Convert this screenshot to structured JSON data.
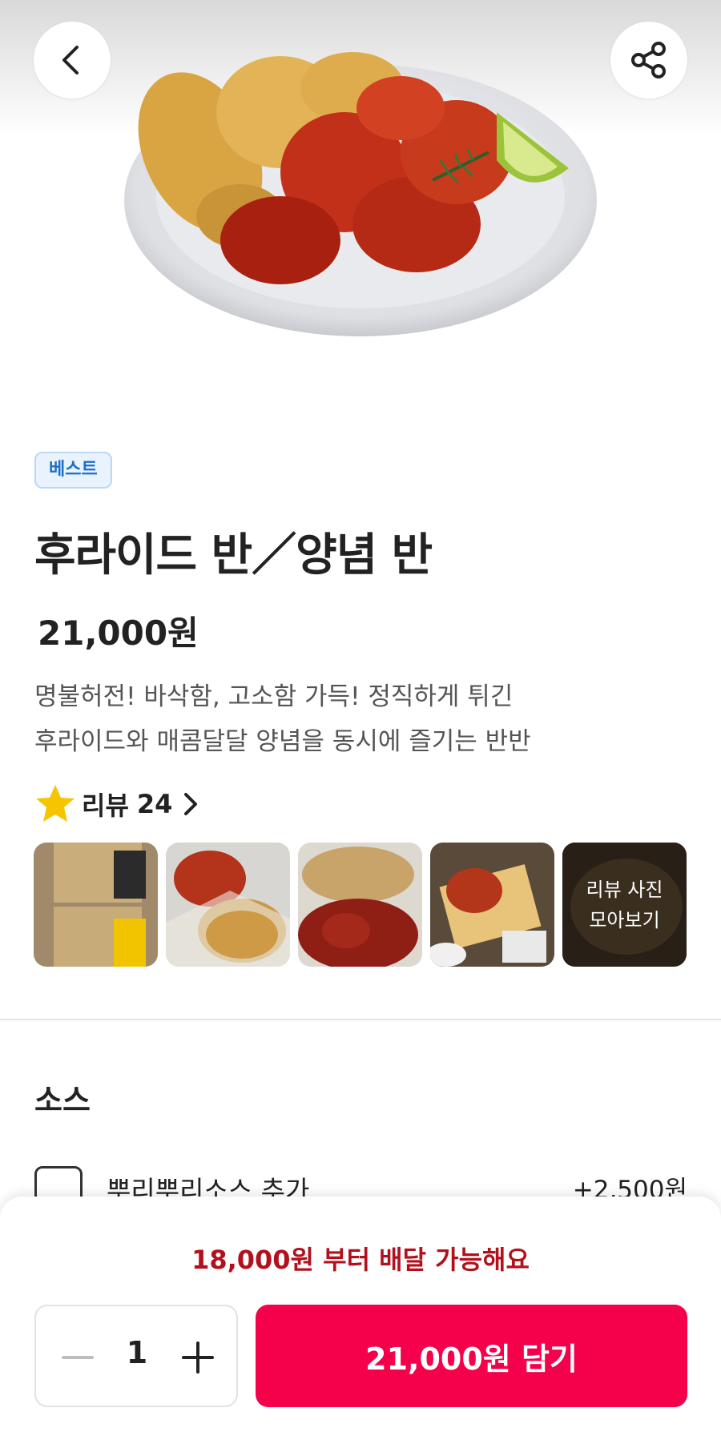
{
  "header": {
    "back_icon": "chevron-left-icon",
    "share_icon": "share-icon"
  },
  "product": {
    "badge": "베스트",
    "title": "후라이드 반／양념 반",
    "price": "21,000원",
    "description_lines": [
      "명불허전! 바삭함, 고소함 가득! 정직하게 튀긴",
      "후라이드와 매콤달달 양념을 동시에 즐기는 반반"
    ]
  },
  "reviews": {
    "label": "리뷰",
    "count": "24",
    "star_color": "#f6c400",
    "photos_more_lines": [
      "리뷰 사진",
      "모아보기"
    ]
  },
  "sauce_section": {
    "title": "소스",
    "options": [
      {
        "label": "뿌리뿌리소스 추가",
        "price": "+2,500원",
        "checked": false
      }
    ]
  },
  "bottom_bar": {
    "min_order": "18,000원 부터 배달 가능해요",
    "quantity": "1",
    "add_button": "21,000원 담기",
    "accent_color": "#f5004a",
    "notice_color": "#b3101c"
  }
}
